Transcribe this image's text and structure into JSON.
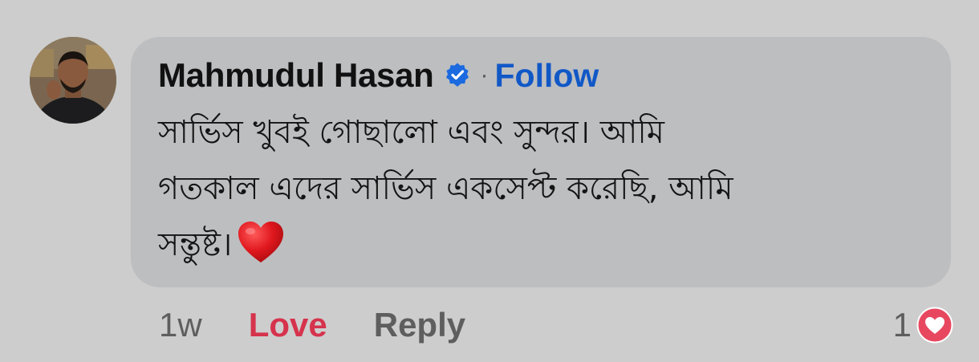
{
  "comment": {
    "author": {
      "name": "Mahmudul Hasan",
      "verified_icon": "verified-badge-icon",
      "separator": "·",
      "follow_label": "Follow"
    },
    "text_lines": [
      "সার্ভিস খুবই গোছালো এবং সুন্দর। আমি",
      "গতকাল এদের সার্ভিস একসেপ্ট করেছি, আমি",
      "সন্তুষ্ট।"
    ],
    "emoji": "red-heart-emoji",
    "actions": {
      "timestamp": "1w",
      "love_label": "Love",
      "reply_label": "Reply"
    },
    "reactions": {
      "count": "1",
      "icon": "love-reaction-icon"
    }
  },
  "colors": {
    "background": "#cdcdcd",
    "bubble": "#bdbec0",
    "follow": "#1158c7",
    "love": "#d6334d",
    "verified": "#1b6ae0",
    "muted_text": "#5e5e5e"
  }
}
